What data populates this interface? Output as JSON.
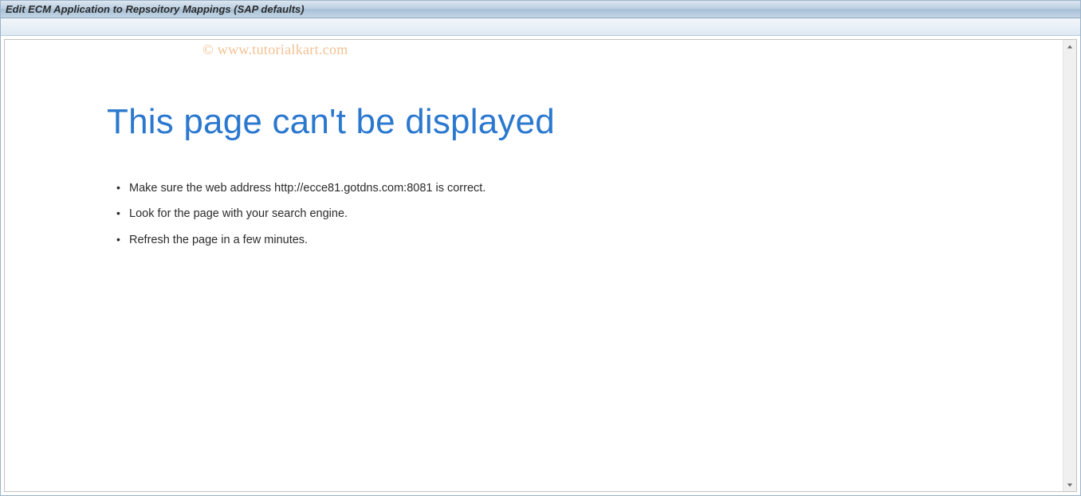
{
  "window": {
    "title": "Edit ECM Application to Repsoitory Mappings (SAP defaults)"
  },
  "watermark": "© www.tutorialkart.com",
  "error": {
    "heading": "This page can't be displayed",
    "items": [
      "Make sure the web address http://ecce81.gotdns.com:8081 is correct.",
      "Look for the page with your search engine.",
      "Refresh the page in a few minutes."
    ]
  }
}
